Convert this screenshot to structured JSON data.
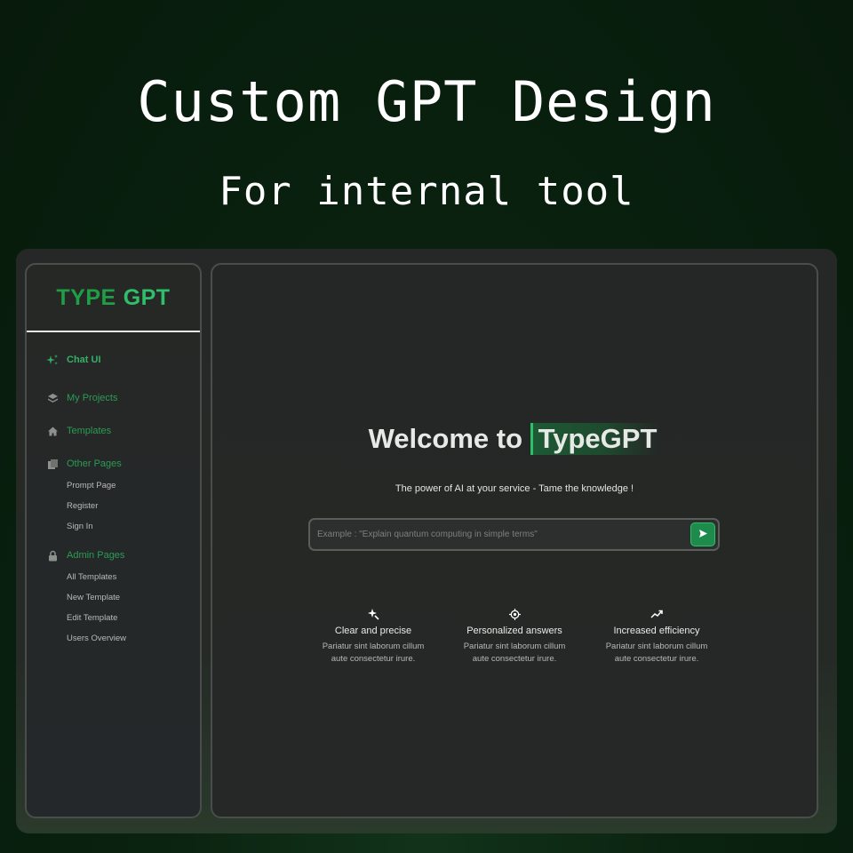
{
  "hero": {
    "title": "Custom GPT Design",
    "subtitle": "For internal tool"
  },
  "sidebar": {
    "brand_part1": "TYPE",
    "brand_part2": "GPT",
    "items": [
      {
        "label": "Chat UI",
        "icon": "sparkle-icon",
        "active": true
      },
      {
        "label": "My Projects",
        "icon": "layers-icon"
      },
      {
        "label": "Templates",
        "icon": "home-icon"
      },
      {
        "label": "Other Pages",
        "icon": "pages-icon"
      },
      {
        "label": "Admin Pages",
        "icon": "lock-icon"
      }
    ],
    "other_pages": [
      "Prompt Page",
      "Register",
      "Sign In"
    ],
    "admin_pages": [
      "All Templates",
      "New Template",
      "Edit Template",
      "Users Overview"
    ]
  },
  "main": {
    "welcome_prefix": "Welcome to ",
    "welcome_brand": "TypeGPT",
    "tagline": "The power of AI at your service - Tame the knowledge !",
    "prompt_placeholder": "Example : \"Explain quantum computing in simple terms\"",
    "send_icon": "send-icon",
    "features": [
      {
        "icon": "magic-icon",
        "title": "Clear and precise",
        "desc_line1": "Pariatur sint laborum cillum",
        "desc_line2": "aute consectetur irure."
      },
      {
        "icon": "target-icon",
        "title": "Personalized answers",
        "desc_line1": "Pariatur sint laborum cillum",
        "desc_line2": "aute consectetur irure."
      },
      {
        "icon": "trend-up-icon",
        "title": "Increased efficiency",
        "desc_line1": "Pariatur sint laborum cillum",
        "desc_line2": "aute consectetur irure."
      }
    ]
  },
  "colors": {
    "accent": "#2fbf6a",
    "accent_dark": "#1f9e45",
    "background": "#0a2210",
    "panel": "#262827"
  }
}
